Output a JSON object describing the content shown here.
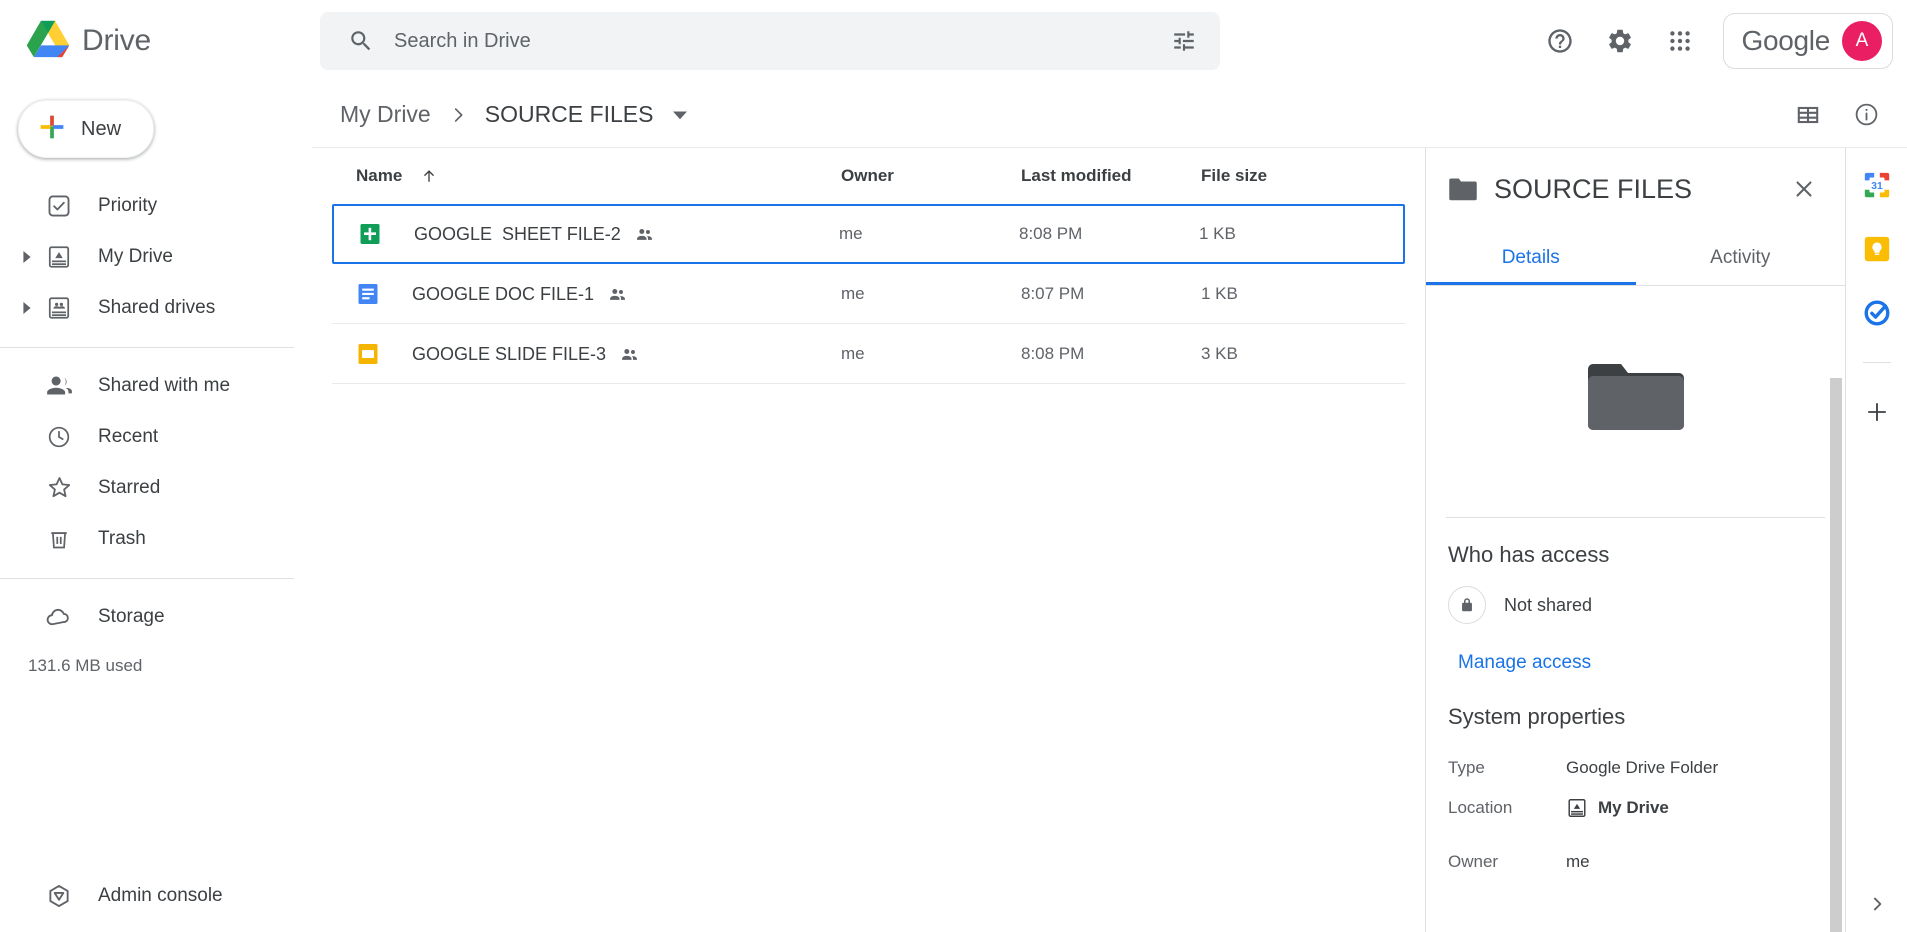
{
  "app": {
    "brand_label": "Drive",
    "logo_icon": "drive-logo-icon"
  },
  "search": {
    "placeholder": "Search in Drive",
    "value": "",
    "search_icon": "search-icon",
    "options_icon": "tune-icon"
  },
  "top_actions": {
    "help_icon": "help-circle-icon",
    "settings_icon": "gear-icon",
    "apps_icon": "apps-grid-icon",
    "account_word": "Google",
    "avatar_letter": "A",
    "avatar_color": "#e91e63"
  },
  "sidebar": {
    "new_button": "New",
    "items": [
      {
        "label": "Priority",
        "icon": "priority-check-icon",
        "expandable": false
      },
      {
        "label": "My Drive",
        "icon": "my-drive-icon",
        "expandable": true
      },
      {
        "label": "Shared drives",
        "icon": "shared-drives-icon",
        "expandable": true
      }
    ],
    "items2": [
      {
        "label": "Shared with me",
        "icon": "people-icon",
        "expandable": false
      },
      {
        "label": "Recent",
        "icon": "clock-icon",
        "expandable": false
      },
      {
        "label": "Starred",
        "icon": "star-icon",
        "expandable": false
      },
      {
        "label": "Trash",
        "icon": "trash-icon",
        "expandable": false
      }
    ],
    "storage": {
      "label": "Storage",
      "icon": "cloud-icon",
      "used": "131.6 MB used"
    },
    "admin_console": {
      "label": "Admin console",
      "icon": "admin-console-icon"
    }
  },
  "breadcrumb": {
    "root": "My Drive",
    "separator": "›",
    "current": "SOURCE FILES",
    "caret_icon": "chevron-down-icon"
  },
  "main_header": {
    "grid_view_icon": "grid-view-icon",
    "details_icon": "info-circle-icon"
  },
  "filelist": {
    "columns": {
      "name": "Name",
      "sort_icon": "arrow-up-icon",
      "owner": "Owner",
      "modified": "Last modified",
      "size": "File size"
    },
    "rows": [
      {
        "name": "GOOGLE  SHEET FILE-2",
        "icon": "google-sheets-icon",
        "icon_color": "#0f9d58",
        "shared_icon": "people-small-icon",
        "owner": "me",
        "modified": "8:08 PM",
        "size": "1 KB",
        "selected": true
      },
      {
        "name": "GOOGLE DOC FILE-1",
        "icon": "google-docs-icon",
        "icon_color": "#4285f4",
        "shared_icon": "people-small-icon",
        "owner": "me",
        "modified": "8:07 PM",
        "size": "1 KB",
        "selected": false
      },
      {
        "name": "GOOGLE SLIDE FILE-3",
        "icon": "google-slides-icon",
        "icon_color": "#f4b400",
        "shared_icon": "people-small-icon",
        "owner": "me",
        "modified": "8:08 PM",
        "size": "3 KB",
        "selected": false
      }
    ]
  },
  "details": {
    "title": "SOURCE FILES",
    "folder_icon": "folder-icon",
    "close_icon": "close-icon",
    "tabs": [
      {
        "label": "Details",
        "active": true
      },
      {
        "label": "Activity",
        "active": false
      }
    ],
    "preview_icon": "folder-large-icon",
    "access": {
      "heading": "Who has access",
      "lock_icon": "lock-icon",
      "status": "Not shared",
      "manage_link": "Manage access",
      "link_color": "#1a73e8"
    },
    "system_properties": {
      "heading": "System properties",
      "rows": [
        {
          "key": "Type",
          "value": "Google Drive Folder",
          "icon": null
        },
        {
          "key": "Location",
          "value": "My Drive",
          "icon": "my-drive-icon"
        },
        {
          "key": "Owner",
          "value": "me",
          "icon": null
        }
      ]
    }
  },
  "rail": {
    "items": [
      {
        "name": "google-calendar-icon",
        "label": "31"
      },
      {
        "name": "google-keep-icon",
        "label": ""
      },
      {
        "name": "google-tasks-icon",
        "label": ""
      }
    ],
    "add_icon": "plus-icon",
    "expand_icon": "chevron-right-icon"
  }
}
